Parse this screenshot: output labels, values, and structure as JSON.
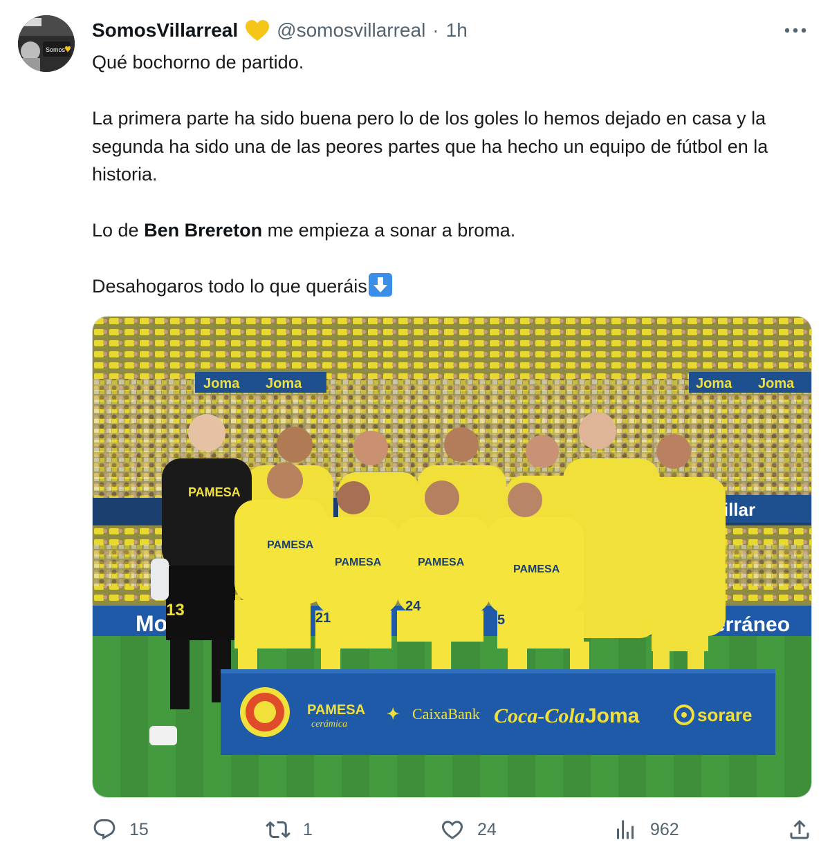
{
  "tweet": {
    "display_name": "SomosVillarreal",
    "handle": "@somosvillarreal",
    "separator": "·",
    "time": "1h",
    "avatar_text": "Somos",
    "paragraphs": {
      "p1": "Qué bochorno de partido.",
      "p2": "La primera parte ha sido buena pero lo de los goles lo hemos dejado en casa y la segunda ha sido una de las peores partes que ha hecho un equipo de fútbol en la historia.",
      "p3_before": "Lo de ",
      "p3_bold": "Ben Brereton",
      "p3_after": " me empieza a sonar a broma.",
      "p4": "Desahogaros todo lo que queráis"
    },
    "media": {
      "banner_left": "Joma",
      "banner_left2": "Joma",
      "banner_right": "Joma",
      "banner_right2": "Joma",
      "ad_board_left": "Mo",
      "ad_board_right": "terráneo",
      "ad_board_top_right": "Villar",
      "sponsor_1": "PAMESA",
      "sponsor_1_sub": "cerámica",
      "sponsor_2": "CaixaBank",
      "sponsor_3": "Coca-Cola",
      "sponsor_4": "Joma",
      "sponsor_5": "sorare",
      "shirt_sponsor": "PAMESA",
      "number_gk": "13",
      "number_a": "21",
      "number_b": "24",
      "number_c": "5"
    },
    "actions": {
      "replies": "15",
      "reposts": "1",
      "likes": "24",
      "views": "962"
    }
  },
  "colors": {
    "text_primary": "#0f1419",
    "text_secondary": "#536471",
    "heart_badge": "#f5c518",
    "kit_yellow": "#f2e03a",
    "board_blue": "#1e5aa8",
    "pitch_green": "#3e8f3a"
  },
  "icons": [
    "avatar-image",
    "gold-heart-icon",
    "more-icon",
    "down-arrow-emoji",
    "reply-icon",
    "repost-icon",
    "like-icon",
    "views-icon",
    "share-icon"
  ]
}
